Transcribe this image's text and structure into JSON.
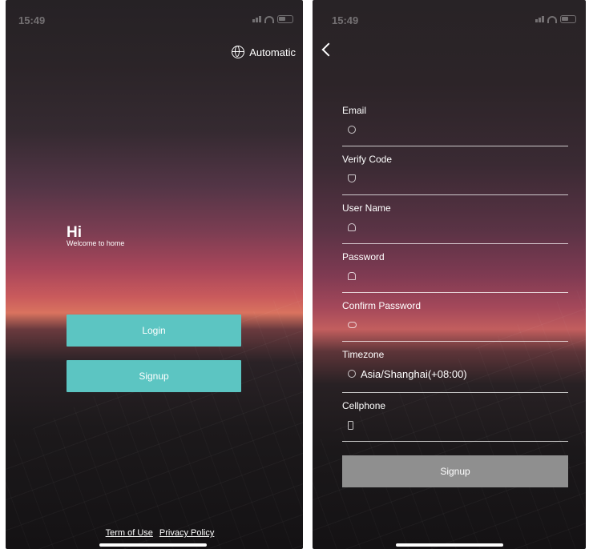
{
  "status": {
    "time": "15:49"
  },
  "login_screen": {
    "language_label": "Automatic",
    "greeting": "Hi",
    "welcome": "Welcome to home",
    "login_label": "Login",
    "signup_label": "Signup",
    "terms_label": "Term of Use",
    "privacy_label": "Privacy Policy"
  },
  "signup_screen": {
    "fields": [
      {
        "label": "Email",
        "value": "",
        "icon": "at-icon"
      },
      {
        "label": "Verify Code",
        "value": "",
        "icon": "shield-icon"
      },
      {
        "label": "User Name",
        "value": "",
        "icon": "user-icon"
      },
      {
        "label": "Password",
        "value": "",
        "icon": "lock-icon"
      },
      {
        "label": "Confirm Password",
        "value": "",
        "icon": "eye-icon"
      },
      {
        "label": "Timezone",
        "value": "Asia/Shanghai(+08:00)",
        "icon": "clock-icon"
      },
      {
        "label": "Cellphone",
        "value": "",
        "icon": "phone-icon"
      }
    ],
    "signup_label": "Signup"
  },
  "colors": {
    "accent": "#5cc5c2",
    "disabled": "#8f8f8f"
  }
}
